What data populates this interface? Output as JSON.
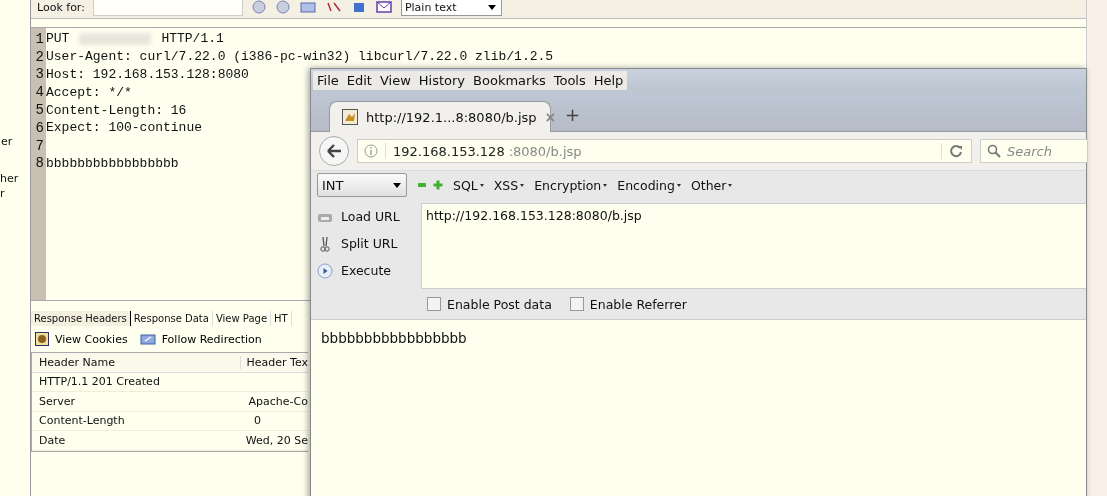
{
  "edge_fragments": [
    "er",
    "her",
    "r"
  ],
  "find_bar": {
    "label": "Look for:",
    "format": "Plain text"
  },
  "editor_lines": [
    {
      "number": "1",
      "text": "PUT",
      "redacted": true,
      "text_after": "HTTP/1.1"
    },
    {
      "number": "2",
      "text": "User-Agent: curl/7.22.0 (i386-pc-win32) libcurl/7.22.0 zlib/1.2.5"
    },
    {
      "number": "3",
      "text": "Host: 192.168.153.128:8080"
    },
    {
      "number": "4",
      "text": "Accept: */*"
    },
    {
      "number": "5",
      "text": "Content-Length: 16"
    },
    {
      "number": "6",
      "text": "Expect: 100-continue"
    },
    {
      "number": "7"
    },
    {
      "number": "8",
      "text": "bbbbbbbbbbbbbbbbb"
    }
  ],
  "result_tabs": [
    {
      "label": "Response Headers",
      "selected": true
    },
    {
      "label": "Response Data",
      "selected": false
    },
    {
      "label": "View Page",
      "selected": false
    },
    {
      "label": "HT",
      "selected": false
    }
  ],
  "result_actions": [
    "View Cookies",
    "Follow Redirection"
  ],
  "headers_table": {
    "columns": [
      "Header Name",
      "Header Tex"
    ],
    "rows": [
      [
        "HTTP/1.1 201 Created",
        ""
      ],
      [
        "Server",
        "Apache-Co"
      ],
      [
        "Content-Length",
        "0"
      ],
      [
        "Date",
        "Wed, 20 Se"
      ]
    ]
  },
  "browser": {
    "menu": [
      "File",
      "Edit",
      "View",
      "History",
      "Bookmarks",
      "Tools",
      "Help"
    ],
    "tab": {
      "title": "http://192.1...8:8080/b.jsp",
      "close": "×"
    },
    "new_tab": "+",
    "address": {
      "host": "192.168.153.128",
      "rest": ":8080/b.jsp"
    },
    "search": {
      "placeholder": "Search"
    },
    "hackbar": {
      "select": "INT",
      "menus": [
        "SQL",
        "XSS",
        "Encryption",
        "Encoding",
        "Other"
      ],
      "actions": [
        {
          "label": "Load URL",
          "kind": "load"
        },
        {
          "label": "Split URL",
          "kind": "split"
        },
        {
          "label": "Execute",
          "kind": "execute"
        }
      ],
      "url": "http://192.168.153.128:8080/b.jsp",
      "options": [
        {
          "label": "Enable Post data",
          "checked": false
        },
        {
          "label": "Enable Referrer",
          "checked": false
        }
      ]
    },
    "page_text": "bbbbbbbbbbbbbbbbb"
  }
}
